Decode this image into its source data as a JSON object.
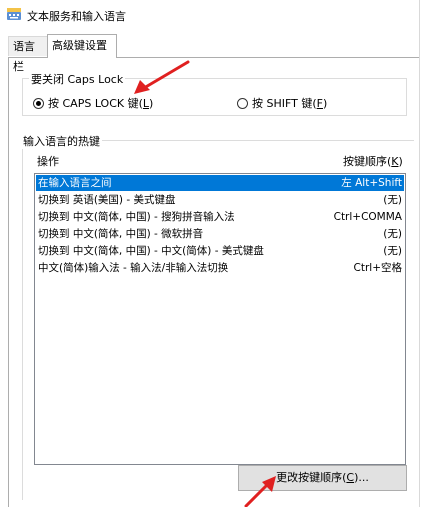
{
  "window": {
    "title": "文本服务和输入语言"
  },
  "tabs": [
    {
      "label": "语言栏"
    },
    {
      "label": "高级键设置"
    }
  ],
  "caps_group": {
    "legend": "要关闭 Caps Lock",
    "option_caps": {
      "label": "按 CAPS LOCK 键(",
      "key": "L",
      "end": ")",
      "checked": true
    },
    "option_shift": {
      "label": "按 SHIFT 键(",
      "key": "F",
      "end": ")",
      "checked": false
    }
  },
  "hotkey_group": {
    "legend": "输入语言的热键",
    "col_action": "操作",
    "col_keys": "按键顺序(",
    "col_keys_key": "K",
    "col_keys_end": ")",
    "rows": [
      {
        "action": "在输入语言之间",
        "keys": "左 Alt+Shift",
        "selected": true
      },
      {
        "action": "切换到 英语(美国) - 美式键盘",
        "keys": "(无)"
      },
      {
        "action": "切换到 中文(简体, 中国) - 搜狗拼音输入法",
        "keys": "Ctrl+COMMA"
      },
      {
        "action": "切换到 中文(简体, 中国) - 微软拼音",
        "keys": "(无)"
      },
      {
        "action": "切换到 中文(简体, 中国) - 中文(简体) - 美式键盘",
        "keys": "(无)"
      },
      {
        "action": "中文(简体)输入法 - 输入法/非输入法切换",
        "keys": "Ctrl+空格"
      }
    ]
  },
  "change_button": {
    "label": "更改按键顺序(",
    "key": "C",
    "end": ")..."
  },
  "colors": {
    "selection": "#0078d7",
    "arrow": "#e02020"
  },
  "icons": {
    "title": "keyboard-icon"
  }
}
